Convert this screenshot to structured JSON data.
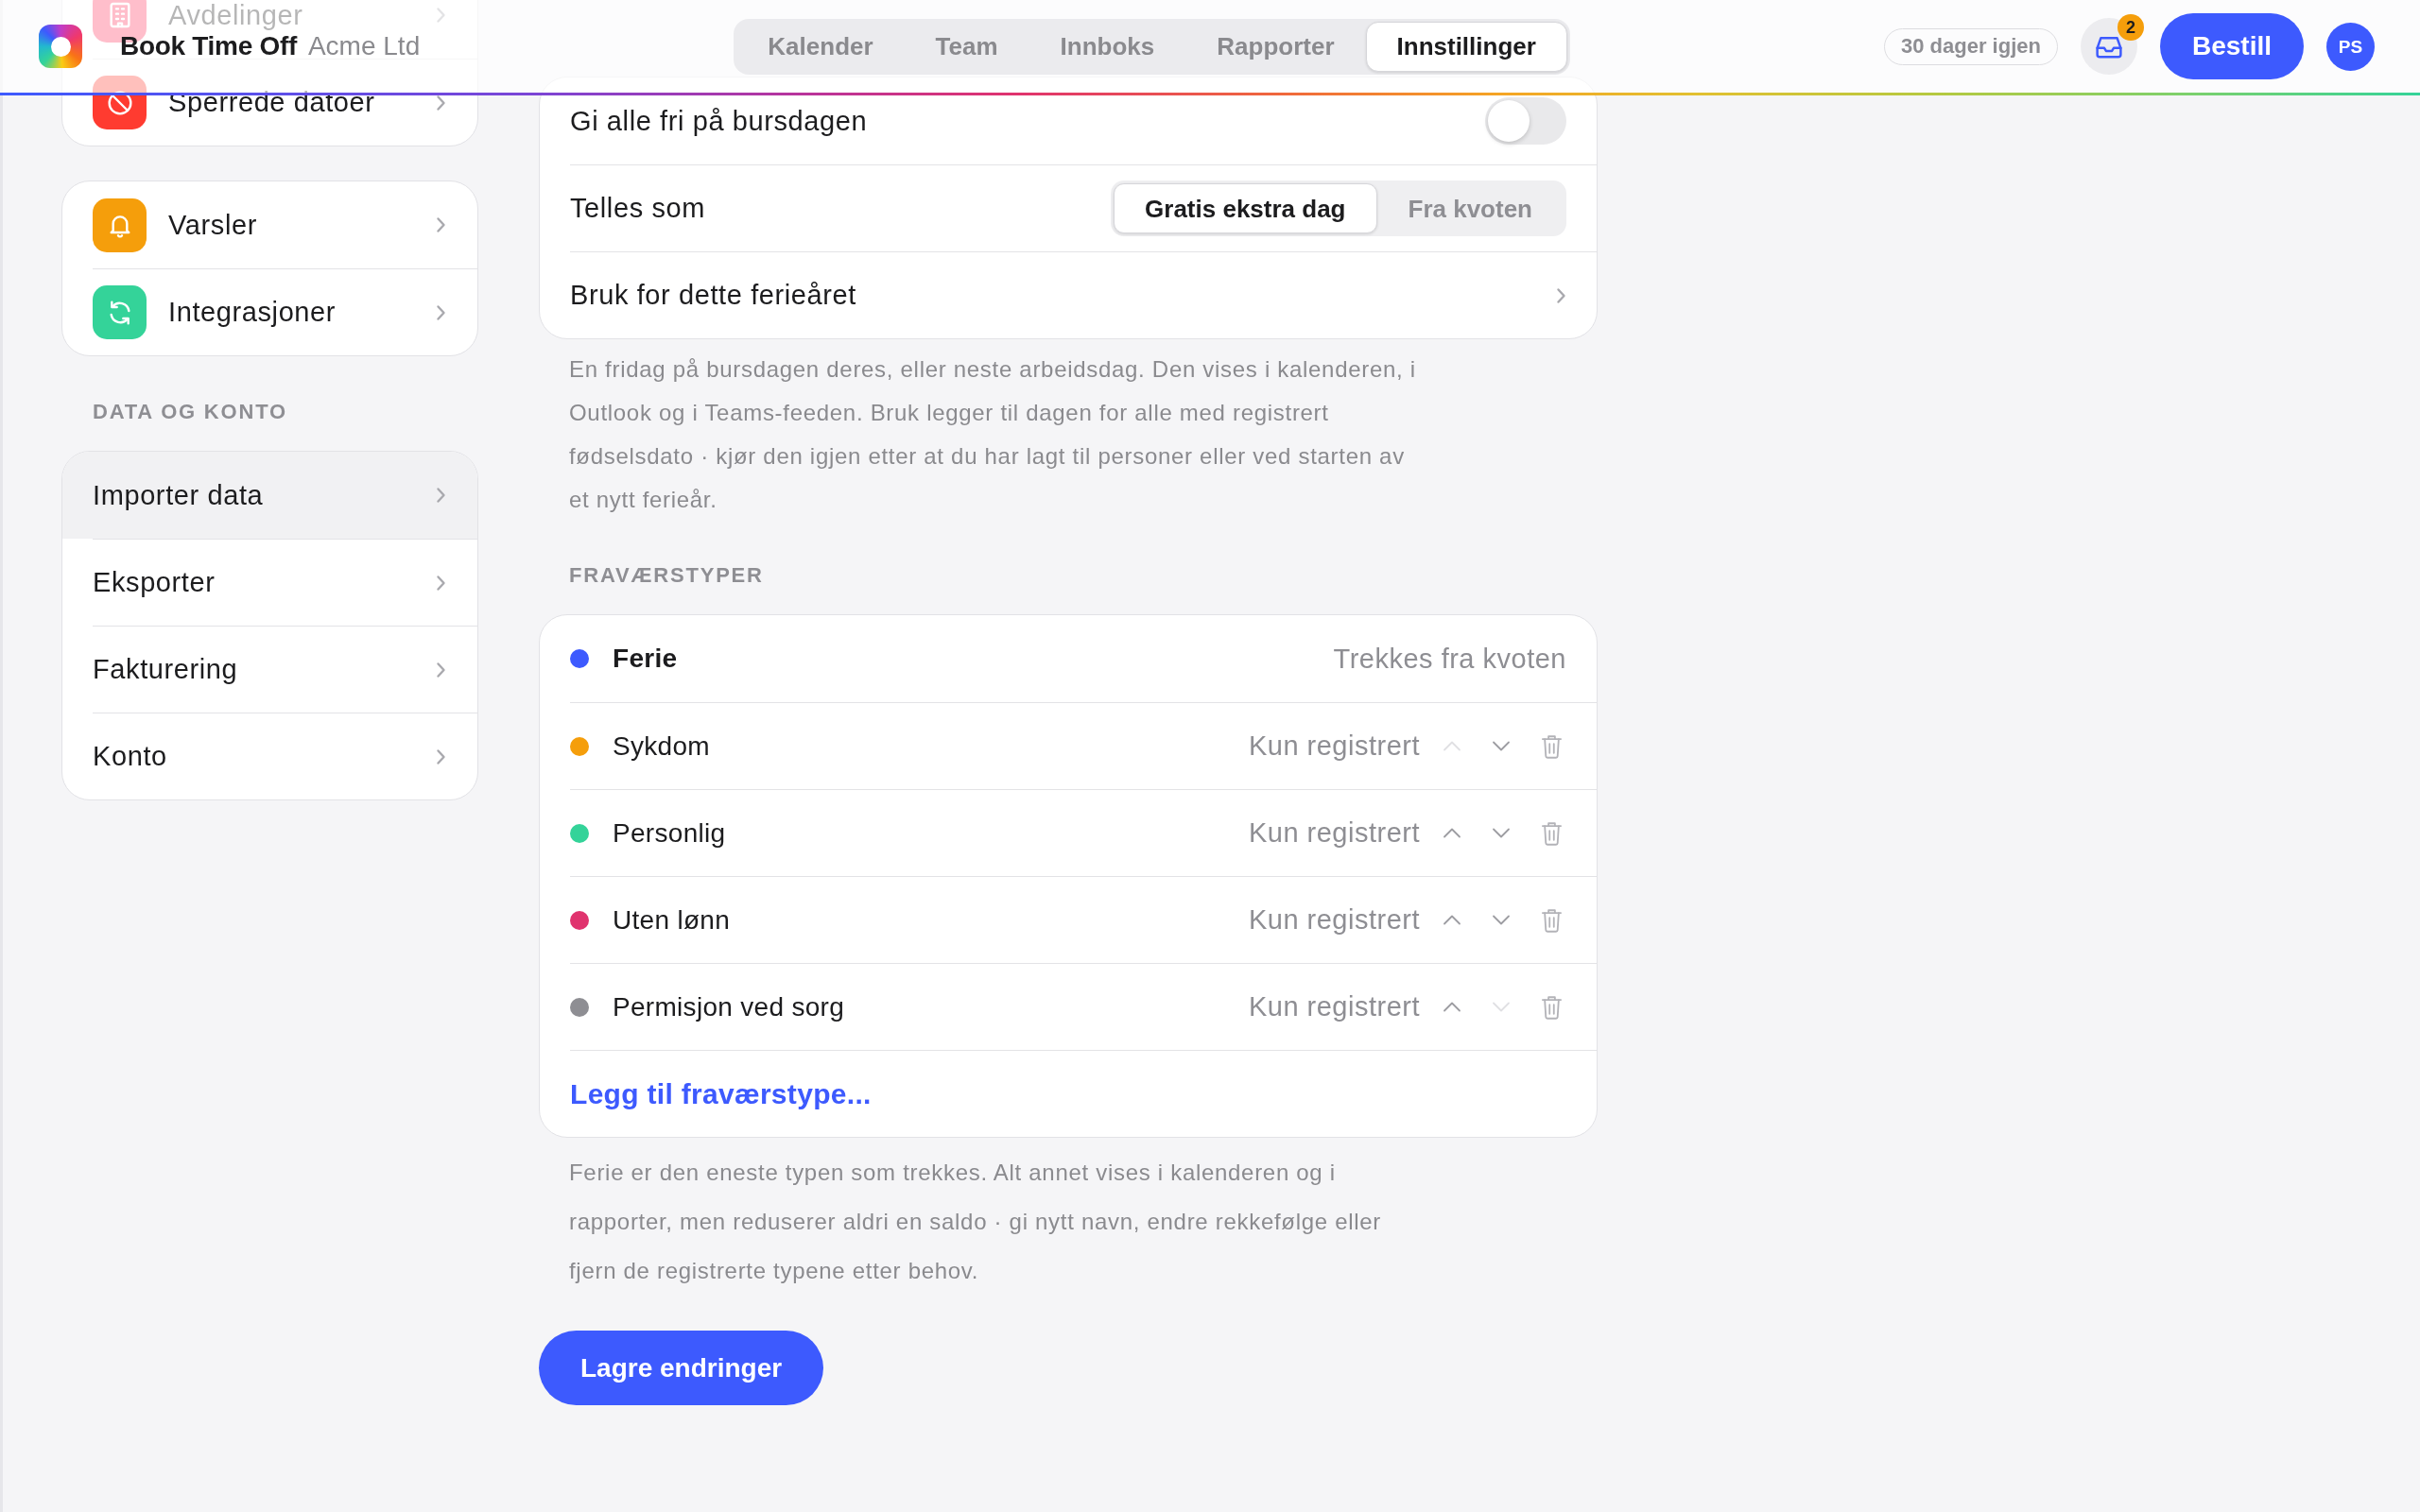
{
  "header": {
    "brand": {
      "name": "Book Time Off",
      "org": "Acme Ltd"
    },
    "tabs": [
      {
        "label": "Kalender",
        "selected": false
      },
      {
        "label": "Team",
        "selected": false
      },
      {
        "label": "Innboks",
        "selected": false
      },
      {
        "label": "Rapporter",
        "selected": false
      },
      {
        "label": "Innstillinger",
        "selected": true
      }
    ],
    "days_left": "30 dager igjen",
    "inbox": {
      "badge": "2"
    },
    "order_button": "Bestill",
    "avatar": "PS"
  },
  "sidebar": {
    "groups": [
      {
        "items": [
          {
            "label": "Avdelinger"
          },
          {
            "label": "Sperrede datoer",
            "selected": false
          }
        ]
      },
      {
        "items": [
          {
            "label": "Varsler",
            "selected": false
          },
          {
            "label": "Integrasjoner",
            "selected": false
          }
        ]
      },
      {
        "heading": "DATA OG KONTO",
        "items": [
          {
            "label": "Importer data",
            "selected": true
          },
          {
            "label": "Eksporter",
            "selected": false
          },
          {
            "label": "Fakturering",
            "selected": false
          },
          {
            "label": "Konto",
            "selected": false
          }
        ]
      }
    ]
  },
  "birthday": {
    "rows": [
      {
        "kind": "toggle",
        "label": "Gi alle fri på bursdagen",
        "on": false
      },
      {
        "kind": "segmented",
        "label": "Telles som",
        "options": [
          {
            "label": "Gratis ekstra dag",
            "selected": true
          },
          {
            "label": "Fra kvoten",
            "selected": false
          }
        ]
      },
      {
        "kind": "link",
        "label": "Bruk for dette ferieåret"
      }
    ],
    "note": "En fridag på bursdagen deres, eller neste arbeidsdag. Den vises i kalenderen, i Outlook og i Teams-feeden. Bruk legger til dagen for alle med registrert fødselsdato · kjør den igjen etter at du har lagt til personer eller ved starten av et nytt ferieår."
  },
  "absence_types": {
    "heading": "FRAVÆRSTYPER",
    "types": [
      {
        "kind": "fixed",
        "name": "Ferie",
        "color": "#3d5afe",
        "status": "Trekkes fra kvoten"
      },
      {
        "kind": "editable",
        "name": "Sykdom",
        "color": "#f59e0b",
        "status": "Kun registrert",
        "up_disabled": true,
        "down_disabled": false
      },
      {
        "kind": "editable",
        "name": "Personlig",
        "color": "#34d399",
        "status": "Kun registrert",
        "up_disabled": false,
        "down_disabled": false
      },
      {
        "kind": "editable",
        "name": "Uten lønn",
        "color": "#e0336e",
        "status": "Kun registrert",
        "up_disabled": false,
        "down_disabled": false
      },
      {
        "kind": "editable",
        "name": "Permisjon ved sorg",
        "color": "#8e8e93",
        "status": "Kun registrert",
        "up_disabled": false,
        "down_disabled": true
      }
    ],
    "add_link": "Legg til fraværstype...",
    "note": "Ferie er den eneste typen som trekkes. Alt annet vises i kalenderen og i rapporter, men reduserer aldri en saldo · gi nytt navn, endre rekkefølge eller fjern de registrerte typene etter behov."
  },
  "save_button": "Lagre endringer"
}
